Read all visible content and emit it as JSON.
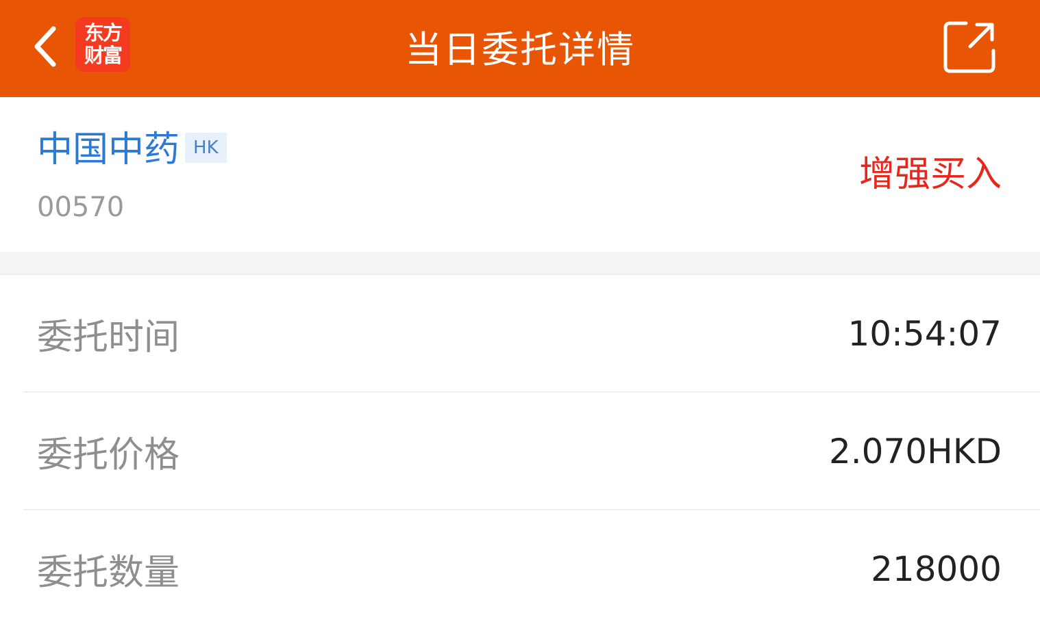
{
  "header": {
    "title": "当日委托详情",
    "logo_line1": "东方",
    "logo_line2": "财富",
    "back_icon": "chevron-left-icon",
    "share_icon": "share-external-icon",
    "background_color": "#e85505"
  },
  "stock": {
    "name": "中国中药",
    "market": "HK",
    "code": "00570",
    "direction": "增强买入",
    "direction_color": "#e8271c",
    "name_color": "#2d7ad6"
  },
  "details": [
    {
      "label": "委托时间",
      "value": "10:54:07"
    },
    {
      "label": "委托价格",
      "value": "2.070HKD"
    },
    {
      "label": "委托数量",
      "value": "218000"
    }
  ]
}
